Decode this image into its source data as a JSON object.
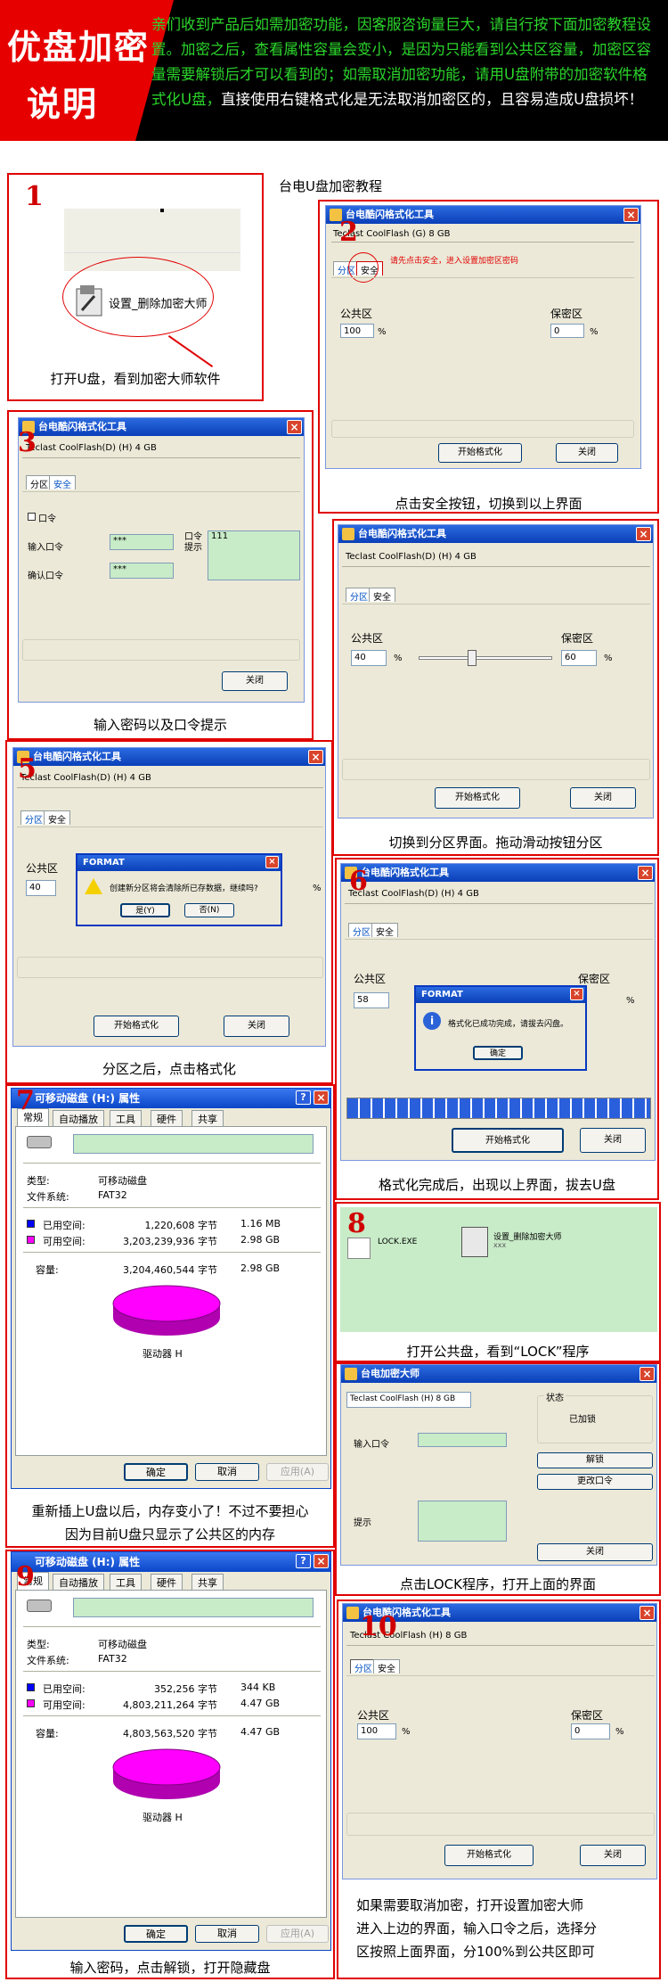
{
  "header": {
    "title_line1": "优盘加密",
    "title_line2": "说明",
    "text_green1": "亲们收到产品后如需加密功能，因客服咨询量巨大，请自行按下面加密教程设置。加密之后，查看属性容量会变小，是因为只能看到公共区容量，加密区容量需要解锁后才可以看到的；如需取消加密功能，请用U盘附带的加密软件格式化U盘，",
    "text_white": "直接使用右键格式化是无法取消加密区的，且容易造成U盘损坏！",
    "colors": {
      "red": "#e60000",
      "green": "#2bd52b",
      "black": "#000000"
    }
  },
  "tutorial_title": "台电U盘加密教程",
  "steps": [
    {
      "num": "1",
      "caption": "打开U盘，看到加密大师软件",
      "file_label": "设置_删除加密大师"
    },
    {
      "num": "2",
      "caption": "点击安全按钮，切换到以上界面",
      "win": {
        "title": "台电酷闪格式化工具",
        "drive": "Teclast CoolFlash      (G) 8 GB",
        "tab1": "分区",
        "tab2": "安全",
        "hint": "请先点击安全，进入设置加密区密码",
        "public": "公共区",
        "secret": "保密区",
        "public_val": "100",
        "secret_val": "0",
        "pct": "%",
        "format_btn": "开始格式化",
        "close_btn": "关闭"
      }
    },
    {
      "num": "3",
      "caption": "输入密码以及口令提示",
      "win": {
        "title": "台电酷闪格式化工具",
        "drive": "Teclast CoolFlash(D)    (H) 4 GB",
        "tab1": "分区",
        "tab2": "安全",
        "check": "口令",
        "input_label": "输入口令",
        "confirm_label": "确认口令",
        "hint_label": "口令提示",
        "pw1": "***",
        "pw2": "***",
        "hint_val": "111",
        "close_btn": "关闭"
      }
    },
    {
      "num": "4",
      "caption": "切换到分区界面。拖动滑动按钮分区",
      "win": {
        "title": "台电酷闪格式化工具",
        "drive": "Teclast CoolFlash(D)    (H) 4 GB",
        "tab1": "分区",
        "tab2": "安全",
        "public": "公共区",
        "secret": "保密区",
        "public_val": "40",
        "secret_val": "60",
        "pct": "%",
        "slider_fraction": 0.4,
        "format_btn": "开始格式化",
        "close_btn": "关闭"
      }
    },
    {
      "num": "5",
      "caption": "分区之后，点击格式化",
      "win": {
        "title": "台电酷闪格式化工具",
        "drive": "Teclast CoolFlash(D)    (H) 4 GB",
        "tab1": "分区",
        "tab2": "安全",
        "public": "公共区",
        "public_val": "40",
        "pct": "%",
        "dialog_title": "FORMAT",
        "dialog_msg": "创建新分区将会清除所已存数据，继续吗?",
        "yes_btn": "是(Y)",
        "no_btn": "否(N)",
        "format_btn": "开始格式化",
        "close_btn": "关闭"
      }
    },
    {
      "num": "6",
      "caption": "格式化完成后，出现以上界面，拔去U盘",
      "win": {
        "title": "台电酷闪格式化工具",
        "drive": "Teclast CoolFlash(D)    (H) 4 GB",
        "tab1": "分区",
        "tab2": "安全",
        "public": "公共区",
        "secret": "保密区",
        "public_val": "58",
        "pct": "%",
        "dialog_title": "FORMAT",
        "dialog_msg": "格式化已成功完成，请拔去闪盘。",
        "ok_btn": "确定",
        "format_btn": "开始格式化",
        "close_btn": "关闭",
        "progress": 1.0
      }
    },
    {
      "num": "7",
      "caption_line1": "重新插上U盘以后，内存变小了！不过不要担心",
      "caption_line2": "因为目前U盘只显示了公共区的内存",
      "win": {
        "title": "可移动磁盘 (H:) 属性",
        "tabs": [
          "常规",
          "自动播放",
          "工具",
          "硬件",
          "共享"
        ],
        "type_label": "类型:",
        "type_val": "可移动磁盘",
        "fs_label": "文件系统:",
        "fs_val": "FAT32",
        "used_label": "已用空间:",
        "used_bytes": "1,220,608 字节",
        "used_h": "1.16 MB",
        "free_label": "可用空间:",
        "free_bytes": "3,203,239,936 字节",
        "free_h": "2.98 GB",
        "cap_label": "容量:",
        "cap_bytes": "3,204,460,544 字节",
        "cap_h": "2.98 GB",
        "drive_label": "驱动器 H",
        "ok": "确定",
        "cancel": "取消",
        "apply": "应用(A)"
      }
    },
    {
      "num": "8",
      "caption": "打开公共盘，看到“LOCK”程序",
      "file1": "LOCK.EXE",
      "file2": "设置_删除加密大师",
      "file2_sub": "xxx"
    },
    {
      "caption": "点击LOCK程序，打开上面的界面",
      "win": {
        "title": "台电加密大师",
        "drive": "Teclast CoolFlash      (H) 8 GB",
        "status_label": "状态",
        "status_val": "已加锁",
        "input_label": "输入口令",
        "unlock_btn": "解锁",
        "change_btn": "更改口令",
        "hint_label": "提示",
        "close_btn": "关闭"
      }
    },
    {
      "num": "9",
      "caption": "输入密码，点击解锁，打开隐藏盘",
      "win": {
        "title": "可移动磁盘 (H:) 属性",
        "tabs": [
          "常规",
          "自动播放",
          "工具",
          "硬件",
          "共享"
        ],
        "type_label": "类型:",
        "type_val": "可移动磁盘",
        "fs_label": "文件系统:",
        "fs_val": "FAT32",
        "used_label": "已用空间:",
        "used_bytes": "352,256 字节",
        "used_h": "344 KB",
        "free_label": "可用空间:",
        "free_bytes": "4,803,211,264 字节",
        "free_h": "4.47 GB",
        "cap_label": "容量:",
        "cap_bytes": "4,803,563,520 字节",
        "cap_h": "4.47 GB",
        "drive_label": "驱动器 H",
        "ok": "确定",
        "cancel": "取消",
        "apply": "应用(A)"
      }
    },
    {
      "num": "10",
      "caption_line1": "如果需要取消加密，打开设置加密大师",
      "caption_line2": "进入上边的界面，输入口令之后，选择分",
      "caption_line3": "区按照上面界面，分100%到公共区即可",
      "win": {
        "title": "台电酷闪格式化工具",
        "drive": "Teclast CoolFlash      (H) 8 GB",
        "tab1": "分区",
        "tab2": "安全",
        "public": "公共区",
        "secret": "保密区",
        "public_val": "100",
        "secret_val": "0",
        "pct": "%",
        "format_btn": "开始格式化",
        "close_btn": "关闭"
      }
    }
  ]
}
